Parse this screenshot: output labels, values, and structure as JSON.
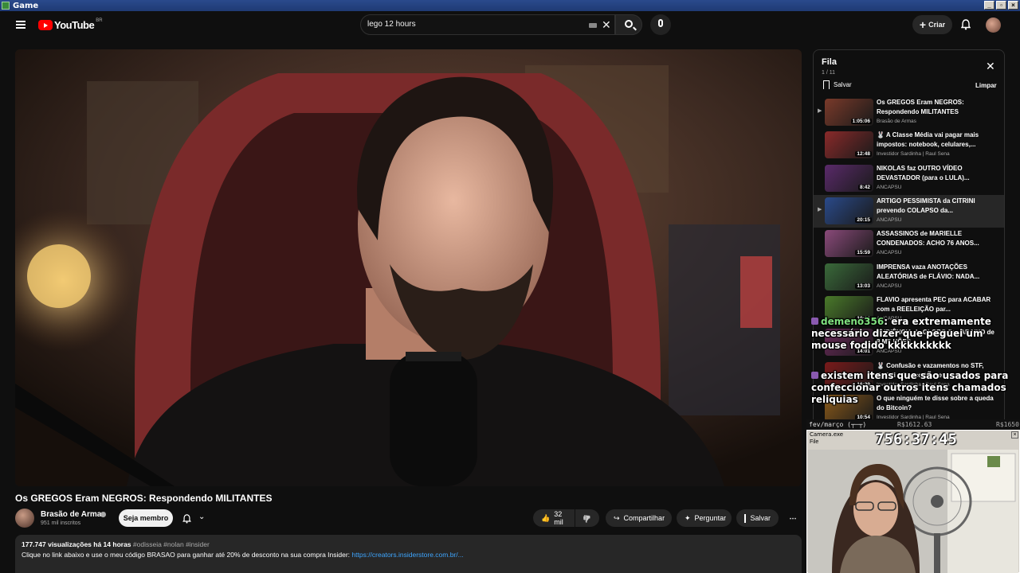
{
  "window": {
    "title": "Game",
    "buttons": [
      "_",
      "▫",
      "×"
    ]
  },
  "topbar": {
    "logo_text": "YouTube",
    "country": "BR",
    "search_value": "lego 12 hours",
    "create_label": "Criar"
  },
  "video": {
    "title": "Os GREGOS Eram NEGROS: Respondendo MILITANTES",
    "channel": "Brasão de Armas",
    "subscribers": "951 mil inscritos",
    "join_label": "Seja membro",
    "likes": "32 mil",
    "share_label": "Compartilhar",
    "ask_label": "Perguntar",
    "save_label": "Salvar",
    "more_label": "⋯"
  },
  "description": {
    "views": "177.747 visualizações",
    "age": "há 14 horas",
    "tags": "#odisseia #nolan #insider",
    "line2": "Clique no link abaixo e use o meu código BRASAO para ganhar até 20% de desconto na sua compra Insider:",
    "link": "https://creators.insiderstore.com.br/..."
  },
  "queue": {
    "title": "Fila",
    "count": "1 / 11",
    "save_label": "Salvar",
    "clear_label": "Limpar",
    "items": [
      {
        "title": "Os GREGOS Eram NEGROS: Respondendo MILITANTES",
        "channel": "Brasão de Armas",
        "duration": "1:05:06",
        "thumb_color": "#7a3a2a",
        "arrow": "▶"
      },
      {
        "title": "🐰 A Classe Média vai pagar mais impostos: notebook, celulares,...",
        "channel": "Investidor Sardinha | Raul Sena",
        "duration": "12:48",
        "thumb_color": "#8a2a2a",
        "arrow": ""
      },
      {
        "title": "NIKOLAS faz OUTRO VÍDEO DEVASTADOR (para o LULA)...",
        "channel": "ANCAPSU",
        "duration": "8:42",
        "thumb_color": "#5a2a6a",
        "arrow": ""
      },
      {
        "title": "ARTIGO PESSIMISTA da CITRINI prevendo COLAPSO da...",
        "channel": "ANCAPSU",
        "duration": "20:15",
        "thumb_color": "#2a4a8a",
        "arrow": "▶"
      },
      {
        "title": "ASSASSINOS de MARIELLE CONDENADOS: ACHO 76 ANOS...",
        "channel": "ANCAPSU",
        "duration": "15:59",
        "thumb_color": "#8a4a7a",
        "arrow": ""
      },
      {
        "title": "IMPRENSA vaza ANOTAÇÕES ALEATÓRIAS de FLÁVIO: NADA...",
        "channel": "ANCAPSU",
        "duration": "13:03",
        "thumb_color": "#3a6a3a",
        "arrow": ""
      },
      {
        "title": "FLAVIO apresenta PEC para ACABAR com a REELEIÇÃO par...",
        "channel": "ANCAPSU",
        "duration": "10:06",
        "thumb_color": "#4a7a2a",
        "arrow": ""
      },
      {
        "title": "AUDIÊNCIA da GLOBO fica ABAIXO de 8 MILHÕES...",
        "channel": "ANCAPSU",
        "duration": "14:01",
        "thumb_color": "#6a2a5a",
        "arrow": ""
      },
      {
        "title": "🐰 Confusão e vazamentos no STF, Toffoli e Banco Master...",
        "channel": "Investidor Sardinha | Raul Sena",
        "duration": "16:29",
        "thumb_color": "#7a1a1a",
        "arrow": ""
      },
      {
        "title": "O que ninguém te disse sobre a queda do Bitcoin?",
        "channel": "Investidor Sardinha | Raul Sena",
        "duration": "10:54",
        "thumb_color": "#8a5a1a",
        "arrow": ""
      }
    ]
  },
  "chat": [
    {
      "user": "demeno356",
      "text": ": era extremamente necessário dizer que peguei um mouse fodido kkkkkkkkkk"
    },
    {
      "user": "",
      "text": "existem itens que são usados para confeccionar outros itens chamados reliquias"
    }
  ],
  "splits": {
    "label": "fev/março (┬─┬)",
    "current": "R$1612.63",
    "target": "R$1650",
    "window_title": "Camera.exe",
    "menu": "File",
    "timer": "756:37:45"
  },
  "colors": {
    "accent": "#ff0000",
    "link": "#3ea6ff",
    "chat_user": "#7fe07f"
  }
}
